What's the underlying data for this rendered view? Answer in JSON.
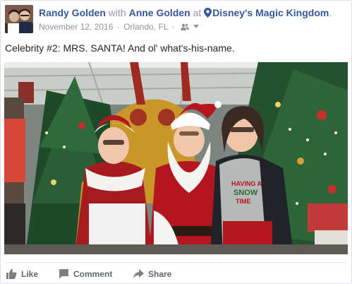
{
  "post": {
    "author": "Randy Golden",
    "with_word": "with",
    "tagged": "Anne Golden",
    "at_word": "at",
    "place": "Disney's Magic Kingdom",
    "period": ".",
    "date": "November 12, 2016",
    "middot": "·",
    "location": "Orlando, FL",
    "caption": "Celebrity #2: MRS. SANTA! And ol' what's-his-name."
  },
  "photo": {
    "shirt_text_line1": "HAVING A",
    "shirt_text_line2": "SNOW",
    "shirt_text_line3": "TIME"
  },
  "actions": {
    "like": "Like",
    "comment": "Comment",
    "share": "Share"
  },
  "icons": {
    "audience": "friends-icon",
    "dropdown": "caret-down-icon",
    "location": "location-pin-icon",
    "like": "thumbs-up-icon",
    "comment": "comment-icon",
    "share": "share-arrow-icon"
  },
  "colors": {
    "link": "#365899",
    "meta": "#90949c",
    "action": "#616770",
    "santa_red": "#b3171d"
  }
}
